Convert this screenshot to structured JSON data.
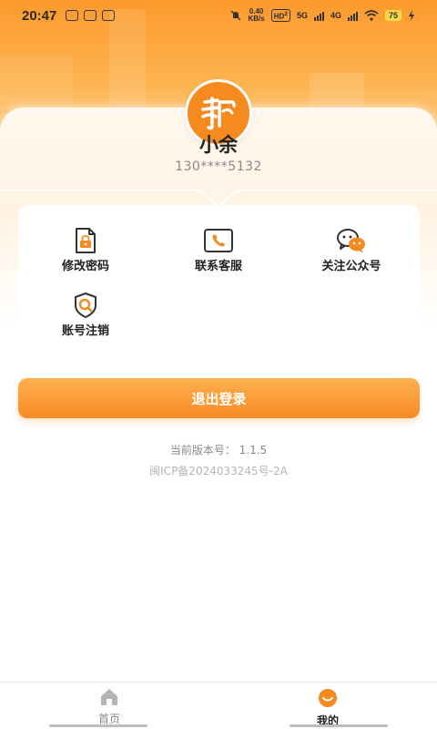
{
  "status_bar": {
    "time": "20:47",
    "net_speed_value": "0.40",
    "net_speed_unit": "KB/s",
    "hd_label": "HD",
    "hd_sub": "2",
    "sig1_label": "5G",
    "sig2_label": "4G",
    "battery": "75"
  },
  "profile": {
    "name": "小余",
    "phone": "130****5132",
    "avatar_icon": "app-logo-icon",
    "accent_color": "#f58a1f"
  },
  "menu": {
    "items": [
      {
        "label": "修改密码",
        "icon": "lock-document-icon"
      },
      {
        "label": "联系客服",
        "icon": "phone-icon"
      },
      {
        "label": "关注公众号",
        "icon": "wechat-icon"
      },
      {
        "label": "账号注销",
        "icon": "shield-search-icon"
      }
    ]
  },
  "logout_label": "退出登录",
  "version_text": "当前版本号： 1.1.5",
  "icp_text": "闽ICP备2024033245号-2A",
  "tabbar": {
    "tabs": [
      {
        "label": "首页",
        "icon": "home-icon",
        "active": false
      },
      {
        "label": "我的",
        "icon": "user-icon",
        "active": true
      }
    ]
  }
}
